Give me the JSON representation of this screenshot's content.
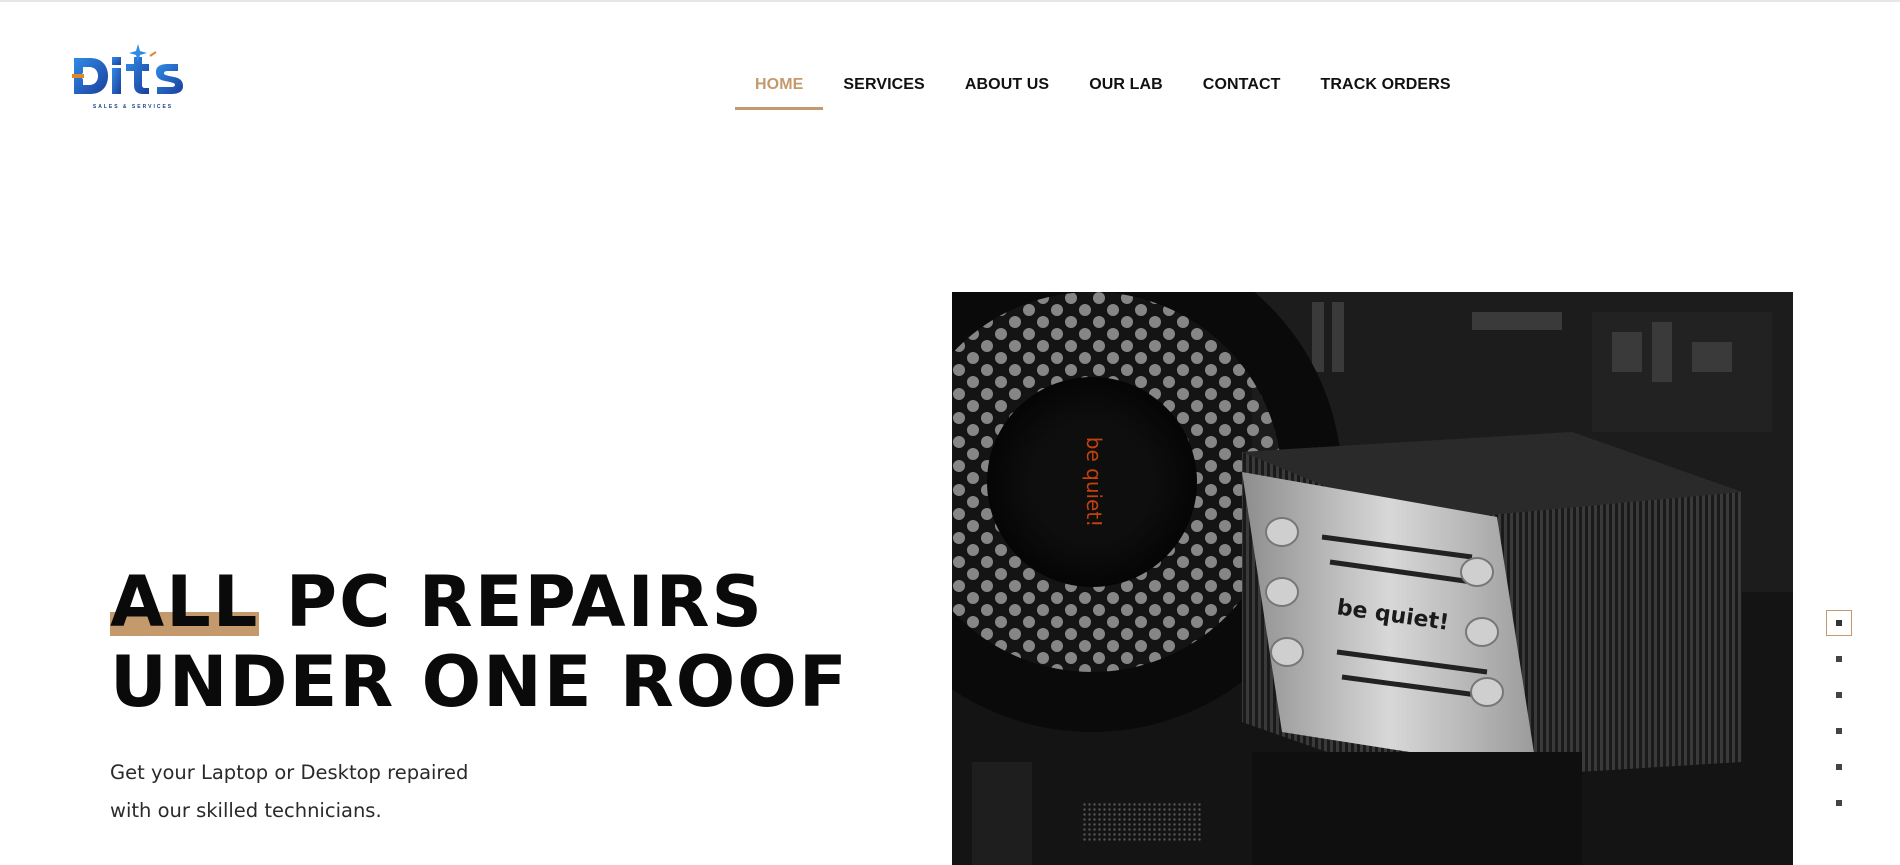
{
  "brand": {
    "logo_text": "Dits",
    "tagline": "SALES & SERVICES",
    "colors": {
      "primary_blue": "#1f6fd1",
      "accent_orange": "#e0872a"
    }
  },
  "nav": {
    "items": [
      {
        "label": "HOME",
        "active": true
      },
      {
        "label": "SERVICES",
        "active": false
      },
      {
        "label": "ABOUT US",
        "active": false
      },
      {
        "label": "OUR LAB",
        "active": false
      },
      {
        "label": "CONTACT",
        "active": false
      },
      {
        "label": "TRACK ORDERS",
        "active": false
      }
    ],
    "active_color": "#c49a6c"
  },
  "hero": {
    "title_highlight": "ALL",
    "title_line1_rest": "PC REPAIRS",
    "title_line2": "UNDER ONE ROOF",
    "subtitle_line1": "Get your Laptop or Desktop repaired",
    "subtitle_line2": "with our skilled technicians.",
    "image": {
      "description_icon": "pc-cooler-photo",
      "printed_text": "be quiet!"
    },
    "highlight_color": "#c49a6c"
  },
  "slider": {
    "slide_count": 6,
    "active_index": 0
  }
}
